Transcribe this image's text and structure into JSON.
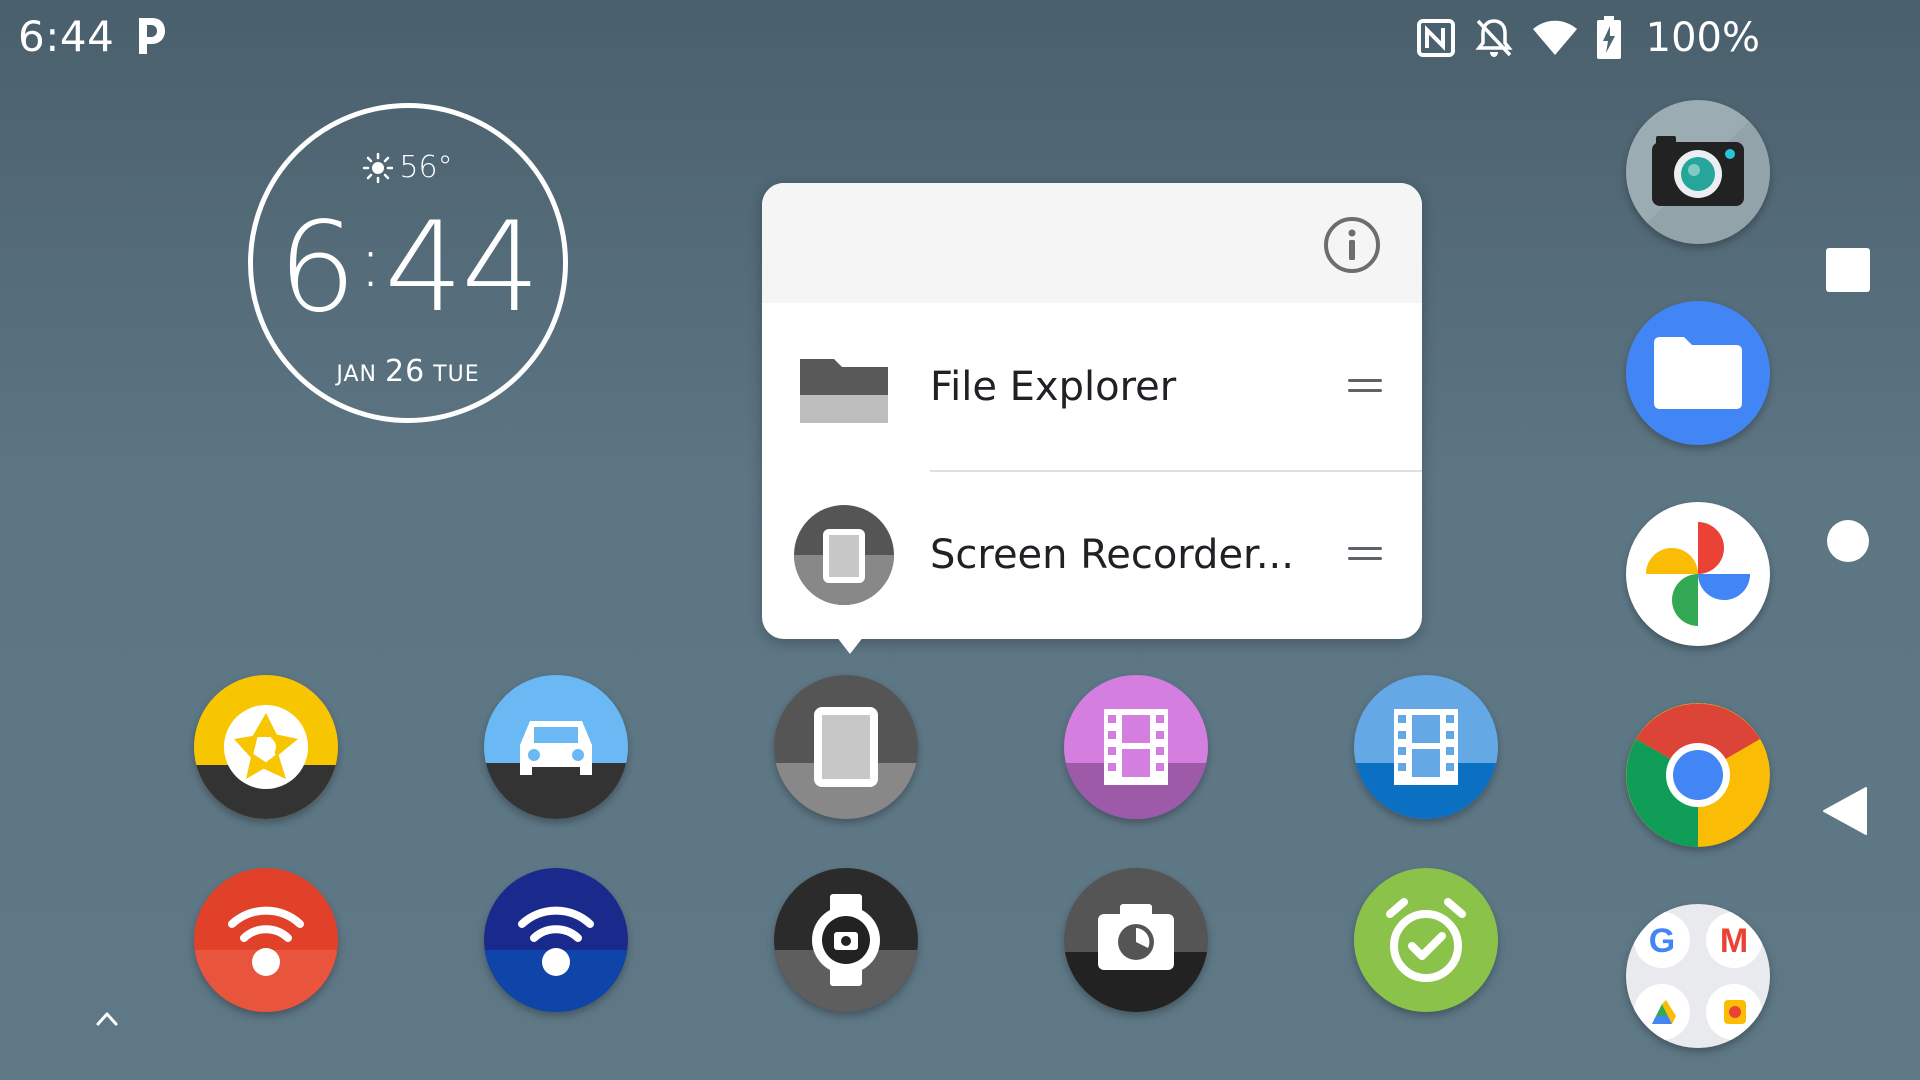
{
  "status_bar": {
    "time": "6:44",
    "battery_percent": "100%",
    "icons": [
      "parking-app-icon",
      "nfc-icon",
      "notifications-off-icon",
      "wifi-icon",
      "battery-charging-icon"
    ]
  },
  "clock_widget": {
    "temperature": "56°",
    "weather_icon": "sun-icon",
    "hour": "6",
    "minutes": "44",
    "month": "JAN",
    "day": "26",
    "weekday": "TUE"
  },
  "shortcut_popup": {
    "info_icon": "info-icon",
    "items": [
      {
        "label": "File Explorer",
        "icon": "folder-icon"
      },
      {
        "label": "Screen Recorder...",
        "icon": "tablet-icon"
      }
    ]
  },
  "home_grid": {
    "rows": [
      [
        {
          "icon": "camera-shutter-icon",
          "colors": [
            "#f7c600",
            "#333333"
          ]
        },
        {
          "icon": "car-icon",
          "colors": [
            "#6ab8f4",
            "#333333"
          ]
        },
        {
          "icon": "tablet-icon",
          "colors": [
            "#555555",
            "#888888"
          ]
        },
        {
          "icon": "film-icon",
          "colors": [
            "#d47fe0",
            "#9c5aa8"
          ]
        },
        {
          "icon": "film-icon",
          "colors": [
            "#64a9e6",
            "#0b6fc2"
          ]
        }
      ],
      [
        {
          "icon": "wifi-dot-icon",
          "colors": [
            "#e14128",
            "#e8553c"
          ]
        },
        {
          "icon": "wifi-dot-icon",
          "colors": [
            "#1a2a8c",
            "#0f45a8"
          ]
        },
        {
          "icon": "watch-camera-icon",
          "colors": [
            "#2b2b2b",
            "#5e5e5e"
          ]
        },
        {
          "icon": "camera-timer-icon",
          "colors": [
            "#555555",
            "#222222"
          ]
        },
        {
          "icon": "alarm-check-icon",
          "colors": [
            "#8bc34a",
            "#8bc34a"
          ]
        }
      ]
    ]
  },
  "dock": {
    "apps": [
      {
        "icon": "camera-app-icon"
      },
      {
        "icon": "files-app-icon"
      },
      {
        "icon": "photos-app-icon"
      },
      {
        "icon": "chrome-app-icon"
      },
      {
        "icon": "google-folder-icon"
      }
    ]
  },
  "nav_bar": {
    "buttons": [
      "recents-button",
      "home-button",
      "back-button"
    ]
  }
}
